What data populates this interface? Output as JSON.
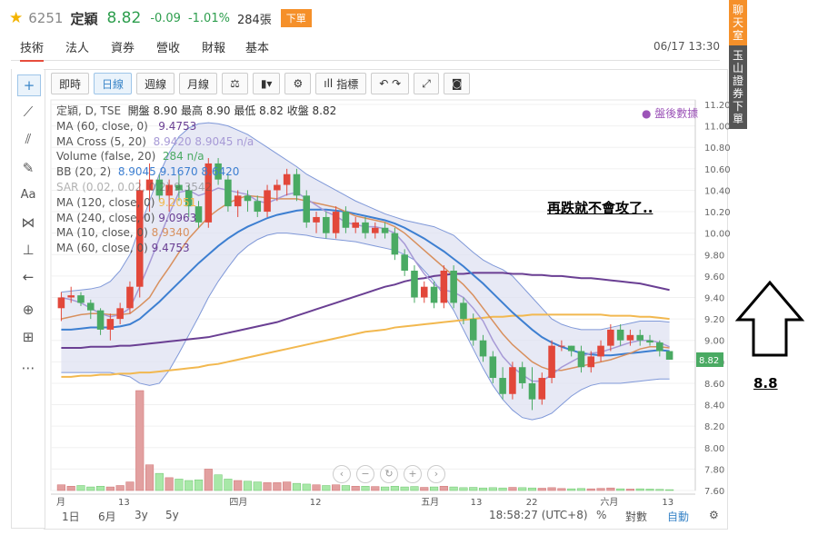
{
  "header": {
    "code": "6251",
    "name": "定穎",
    "price": "8.82",
    "change": "-0.09",
    "pct": "-1.01%",
    "volume": "284張",
    "sell": "下單"
  },
  "tabs": [
    {
      "label": "技術"
    },
    {
      "label": "法人"
    },
    {
      "label": "資券"
    },
    {
      "label": "營收"
    },
    {
      "label": "財報"
    },
    {
      "label": "基本"
    }
  ],
  "time": "06/17 13:30",
  "side_tabs": {
    "chat": "聊天室",
    "broker": "玉山證券下單"
  },
  "toolbar": {
    "realtime": "即時",
    "daily": "日線",
    "weekly": "週線",
    "monthly": "月線",
    "indicator": "指標"
  },
  "legend": {
    "l1": "定穎, D, TSE",
    "l1b": "開盤 8.90 最高 8.90 最低 8.82 收盤 8.82",
    "l2": "MA (60, close, 0)",
    "l2v": "9.4753",
    "l3": "MA Cross (5, 20)",
    "l3v": "8.9420  8.9045  n/a",
    "l4": "Volume (false, 20)",
    "l4v": "284  n/a",
    "l5": "BB (20, 2)",
    "l5v": "8.9045  9.1670  8.6420",
    "l6": "SAR (0.02, 0.02, 0.2)",
    "l6v": "9.3542",
    "l7": "MA (120, close, 0)",
    "l7v": "9.2051",
    "l8": "MA (240, close, 0)",
    "l8v": "9.0963",
    "l9": "MA (10, close, 0)",
    "l9v": "8.9340",
    "l10": "MA (60, close, 0)",
    "l10v": "9.4753"
  },
  "after_hours": "● 盤後數據",
  "annotation": "再跌就不會攻了..",
  "annotation_price": "8.8",
  "bottom": {
    "r1d": "1日",
    "r6m": "6月",
    "r3y": "3y",
    "r5y": "5y",
    "clock": "18:58:27 (UTC+8)",
    "pct": "%",
    "log": "對數",
    "auto": "自動"
  },
  "colors": {
    "up": "#e2473a",
    "down": "#4aaa63",
    "ma_fast": "#a79ad6",
    "ma_mid": "#d8905e",
    "ma_slow": "#6a3f93",
    "ma_long": "#f2b84f",
    "bb_mid": "#3d7fd1",
    "bb_band": "#dfe2f2"
  },
  "chart_data": {
    "type": "candlestick",
    "yticks": [
      "11.20",
      "11.00",
      "10.80",
      "10.60",
      "10.40",
      "10.20",
      "10.00",
      "9.80",
      "9.60",
      "9.40",
      "9.20",
      "9.00",
      "8.80",
      "8.60",
      "8.40",
      "8.20",
      "8.00",
      "7.80",
      "7.60"
    ],
    "ylim": [
      7.6,
      11.2
    ],
    "xticks": [
      "月",
      "13",
      "四月",
      "12",
      "五月",
      "13",
      "22",
      "六月",
      "13"
    ],
    "last_price_label": "8.82",
    "candles": [
      [
        9.3,
        9.45,
        9.18,
        9.4
      ],
      [
        9.4,
        9.5,
        9.35,
        9.42
      ],
      [
        9.42,
        9.45,
        9.32,
        9.35
      ],
      [
        9.35,
        9.38,
        9.2,
        9.28
      ],
      [
        9.28,
        9.3,
        9.05,
        9.1
      ],
      [
        9.1,
        9.25,
        9.0,
        9.2
      ],
      [
        9.2,
        9.35,
        9.15,
        9.3
      ],
      [
        9.3,
        9.55,
        9.25,
        9.5
      ],
      [
        9.5,
        10.5,
        9.4,
        10.4
      ],
      [
        10.4,
        10.65,
        10.2,
        10.5
      ],
      [
        10.5,
        10.55,
        10.3,
        10.35
      ],
      [
        10.35,
        10.5,
        10.2,
        10.45
      ],
      [
        10.45,
        10.55,
        10.3,
        10.4
      ],
      [
        10.4,
        10.45,
        10.15,
        10.25
      ],
      [
        10.25,
        10.3,
        10.05,
        10.1
      ],
      [
        10.1,
        10.7,
        10.05,
        10.65
      ],
      [
        10.65,
        10.7,
        10.45,
        10.5
      ],
      [
        10.5,
        10.55,
        10.2,
        10.25
      ],
      [
        10.25,
        10.4,
        10.15,
        10.35
      ],
      [
        10.35,
        10.4,
        10.2,
        10.3
      ],
      [
        10.3,
        10.35,
        10.15,
        10.2
      ],
      [
        10.2,
        10.45,
        10.15,
        10.4
      ],
      [
        10.4,
        10.5,
        10.3,
        10.45
      ],
      [
        10.45,
        10.6,
        10.35,
        10.55
      ],
      [
        10.55,
        10.6,
        10.3,
        10.35
      ],
      [
        10.35,
        10.4,
        10.05,
        10.1
      ],
      [
        10.1,
        10.2,
        10.0,
        10.15
      ],
      [
        10.15,
        10.2,
        9.95,
        10.0
      ],
      [
        10.0,
        10.25,
        9.95,
        10.2
      ],
      [
        10.2,
        10.25,
        10.0,
        10.05
      ],
      [
        10.05,
        10.15,
        10.0,
        10.1
      ],
      [
        10.1,
        10.15,
        9.95,
        10.0
      ],
      [
        10.0,
        10.1,
        9.95,
        10.05
      ],
      [
        10.05,
        10.1,
        9.95,
        10.0
      ],
      [
        10.0,
        10.05,
        9.75,
        9.8
      ],
      [
        9.8,
        9.85,
        9.6,
        9.65
      ],
      [
        9.65,
        9.7,
        9.35,
        9.4
      ],
      [
        9.4,
        9.55,
        9.35,
        9.5
      ],
      [
        9.5,
        9.55,
        9.3,
        9.35
      ],
      [
        9.35,
        9.7,
        9.3,
        9.65
      ],
      [
        9.65,
        9.7,
        9.3,
        9.35
      ],
      [
        9.35,
        9.4,
        9.15,
        9.2
      ],
      [
        9.2,
        9.25,
        8.95,
        9.0
      ],
      [
        9.0,
        9.05,
        8.8,
        8.85
      ],
      [
        8.85,
        8.9,
        8.6,
        8.65
      ],
      [
        8.65,
        8.75,
        8.45,
        8.5
      ],
      [
        8.5,
        8.8,
        8.45,
        8.75
      ],
      [
        8.75,
        8.8,
        8.55,
        8.6
      ],
      [
        8.6,
        8.75,
        8.35,
        8.45
      ],
      [
        8.45,
        8.7,
        8.4,
        8.65
      ],
      [
        8.65,
        9.0,
        8.6,
        8.95
      ],
      [
        8.95,
        9.0,
        8.9,
        8.95
      ],
      [
        8.95,
        8.95,
        8.85,
        8.9
      ],
      [
        8.9,
        8.95,
        8.7,
        8.75
      ],
      [
        8.75,
        8.9,
        8.7,
        8.85
      ],
      [
        8.85,
        9.0,
        8.8,
        8.95
      ],
      [
        8.95,
        9.15,
        8.9,
        9.1
      ],
      [
        9.1,
        9.15,
        8.95,
        9.0
      ],
      [
        9.0,
        9.1,
        8.95,
        9.05
      ],
      [
        9.05,
        9.1,
        8.95,
        9.0
      ],
      [
        9.0,
        9.05,
        8.95,
        8.98
      ],
      [
        8.98,
        9.0,
        8.85,
        8.9
      ],
      [
        8.9,
        8.9,
        8.82,
        8.82
      ]
    ],
    "volumes": [
      40,
      30,
      35,
      25,
      30,
      25,
      35,
      60,
      700,
      180,
      120,
      90,
      80,
      70,
      75,
      150,
      110,
      80,
      70,
      65,
      60,
      55,
      55,
      60,
      50,
      45,
      40,
      35,
      40,
      35,
      30,
      30,
      28,
      25,
      30,
      25,
      28,
      22,
      25,
      30,
      25,
      20,
      22,
      18,
      20,
      18,
      22,
      20,
      18,
      16,
      20,
      14,
      12,
      14,
      12,
      15,
      18,
      12,
      10,
      12,
      10,
      8,
      6
    ],
    "ma5": [
      9.4,
      9.38,
      9.35,
      9.3,
      9.25,
      9.22,
      9.24,
      9.3,
      9.5,
      9.72,
      9.95,
      10.18,
      10.38,
      10.4,
      10.35,
      10.38,
      10.42,
      10.4,
      10.38,
      10.36,
      10.3,
      10.28,
      10.32,
      10.36,
      10.38,
      10.32,
      10.26,
      10.2,
      10.16,
      10.1,
      10.08,
      10.06,
      10.06,
      10.04,
      10.0,
      9.9,
      9.75,
      9.62,
      9.52,
      9.47,
      9.45,
      9.4,
      9.3,
      9.18,
      9.0,
      8.85,
      8.75,
      8.68,
      8.62,
      8.62,
      8.68,
      8.75,
      8.8,
      8.85,
      8.88,
      8.89,
      8.92,
      8.95,
      8.98,
      9.0,
      9.0,
      8.98,
      8.94
    ],
    "ma10": [
      9.2,
      9.22,
      9.24,
      9.25,
      9.25,
      9.24,
      9.24,
      9.25,
      9.32,
      9.4,
      9.55,
      9.68,
      9.82,
      9.95,
      10.05,
      10.15,
      10.22,
      10.28,
      10.32,
      10.35,
      10.34,
      10.33,
      10.32,
      10.32,
      10.32,
      10.3,
      10.28,
      10.26,
      10.24,
      10.2,
      10.16,
      10.14,
      10.12,
      10.1,
      10.06,
      10.0,
      9.92,
      9.84,
      9.76,
      9.68,
      9.6,
      9.52,
      9.42,
      9.3,
      9.18,
      9.06,
      8.96,
      8.88,
      8.8,
      8.75,
      8.72,
      8.72,
      8.74,
      8.76,
      8.78,
      8.8,
      8.82,
      8.85,
      8.88,
      8.92,
      8.94,
      8.94,
      8.93
    ],
    "ma20": [
      9.1,
      9.1,
      9.11,
      9.12,
      9.12,
      9.12,
      9.13,
      9.15,
      9.2,
      9.28,
      9.36,
      9.45,
      9.54,
      9.63,
      9.72,
      9.8,
      9.88,
      9.95,
      10.01,
      10.06,
      10.1,
      10.14,
      10.17,
      10.19,
      10.21,
      10.22,
      10.22,
      10.22,
      10.21,
      10.2,
      10.18,
      10.16,
      10.14,
      10.12,
      10.09,
      10.05,
      10.0,
      9.95,
      9.89,
      9.83,
      9.76,
      9.69,
      9.61,
      9.53,
      9.44,
      9.35,
      9.26,
      9.18,
      9.1,
      9.03,
      8.98,
      8.94,
      8.91,
      8.88,
      8.87,
      8.86,
      8.86,
      8.87,
      8.88,
      8.89,
      8.9,
      8.91,
      8.9
    ],
    "ma120": [
      8.93,
      8.93,
      8.93,
      8.94,
      8.94,
      8.94,
      8.95,
      8.95,
      8.96,
      8.97,
      8.98,
      8.99,
      9.0,
      9.01,
      9.02,
      9.03,
      9.05,
      9.07,
      9.09,
      9.11,
      9.13,
      9.15,
      9.17,
      9.2,
      9.23,
      9.26,
      9.29,
      9.32,
      9.35,
      9.38,
      9.41,
      9.44,
      9.47,
      9.5,
      9.52,
      9.55,
      9.57,
      9.58,
      9.6,
      9.61,
      9.62,
      9.62,
      9.63,
      9.63,
      9.63,
      9.63,
      9.62,
      9.62,
      9.61,
      9.61,
      9.6,
      9.6,
      9.59,
      9.58,
      9.58,
      9.57,
      9.56,
      9.55,
      9.54,
      9.53,
      9.51,
      9.49,
      9.47
    ],
    "ma240": [
      8.66,
      8.66,
      8.67,
      8.67,
      8.68,
      8.68,
      8.69,
      8.69,
      8.7,
      8.7,
      8.71,
      8.72,
      8.73,
      8.74,
      8.75,
      8.77,
      8.78,
      8.8,
      8.82,
      8.84,
      8.86,
      8.88,
      8.9,
      8.92,
      8.94,
      8.96,
      8.98,
      9.0,
      9.02,
      9.04,
      9.06,
      9.08,
      9.09,
      9.1,
      9.12,
      9.13,
      9.14,
      9.15,
      9.16,
      9.17,
      9.18,
      9.19,
      9.2,
      9.21,
      9.22,
      9.22,
      9.23,
      9.23,
      9.24,
      9.24,
      9.24,
      9.24,
      9.24,
      9.24,
      9.24,
      9.24,
      9.23,
      9.23,
      9.23,
      9.22,
      9.22,
      9.21,
      9.2
    ],
    "bb_upper": [
      9.45,
      9.46,
      9.47,
      9.48,
      9.5,
      9.55,
      9.65,
      9.8,
      10.05,
      10.3,
      10.55,
      10.75,
      10.9,
      10.98,
      11.02,
      11.03,
      11.02,
      11.0,
      10.96,
      10.92,
      10.86,
      10.8,
      10.74,
      10.68,
      10.62,
      10.55,
      10.5,
      10.45,
      10.4,
      10.35,
      10.3,
      10.26,
      10.22,
      10.18,
      10.15,
      10.12,
      10.1,
      10.08,
      10.06,
      10.02,
      9.98,
      9.9,
      9.82,
      9.75,
      9.7,
      9.66,
      9.6,
      9.5,
      9.4,
      9.3,
      9.2,
      9.15,
      9.12,
      9.1,
      9.1,
      9.1,
      9.12,
      9.14,
      9.16,
      9.18,
      9.18,
      9.18,
      9.17
    ],
    "bb_lower": [
      8.7,
      8.7,
      8.7,
      8.7,
      8.7,
      8.7,
      8.68,
      8.66,
      8.6,
      8.58,
      8.6,
      8.72,
      8.88,
      9.05,
      9.22,
      9.4,
      9.55,
      9.68,
      9.8,
      9.88,
      9.94,
      9.98,
      10.0,
      10.0,
      9.99,
      9.98,
      9.96,
      9.95,
      9.94,
      9.93,
      9.92,
      9.9,
      9.88,
      9.86,
      9.84,
      9.8,
      9.75,
      9.65,
      9.55,
      9.42,
      9.28,
      9.1,
      8.92,
      8.74,
      8.58,
      8.45,
      8.35,
      8.28,
      8.26,
      8.28,
      8.32,
      8.4,
      8.48,
      8.54,
      8.58,
      8.6,
      8.6,
      8.6,
      8.61,
      8.62,
      8.63,
      8.64,
      8.64
    ]
  }
}
